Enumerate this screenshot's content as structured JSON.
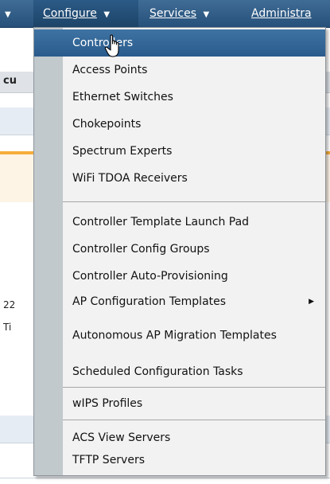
{
  "navbar": {
    "configure_label": "Configure",
    "services_label": "Services",
    "admin_label": "Administra",
    "caret": "▼"
  },
  "background": {
    "header_text": "cu",
    "number_text": "22",
    "ti_text": "Ti"
  },
  "menu": {
    "items": [
      {
        "label": "Controllers"
      },
      {
        "label": "Access Points"
      },
      {
        "label": "Ethernet Switches"
      },
      {
        "label": "Chokepoints"
      },
      {
        "label": "Spectrum Experts"
      },
      {
        "label": "WiFi TDOA Receivers"
      },
      {
        "label": "Controller Template Launch Pad"
      },
      {
        "label": "Controller Config Groups"
      },
      {
        "label": "Controller Auto-Provisioning"
      },
      {
        "label": "AP Configuration Templates"
      },
      {
        "label": "Autonomous AP Migration Templates"
      },
      {
        "label": "Scheduled Configuration Tasks"
      },
      {
        "label": "wIPS Profiles"
      },
      {
        "label": "ACS View Servers"
      },
      {
        "label": "TFTP Servers"
      }
    ],
    "submenu_arrow": "▶"
  },
  "colors": {
    "navbar": "#26507a",
    "menu_bg": "#f2f2f2",
    "menu_gutter": "#c1c9cd",
    "active_item": "#2f6296"
  }
}
